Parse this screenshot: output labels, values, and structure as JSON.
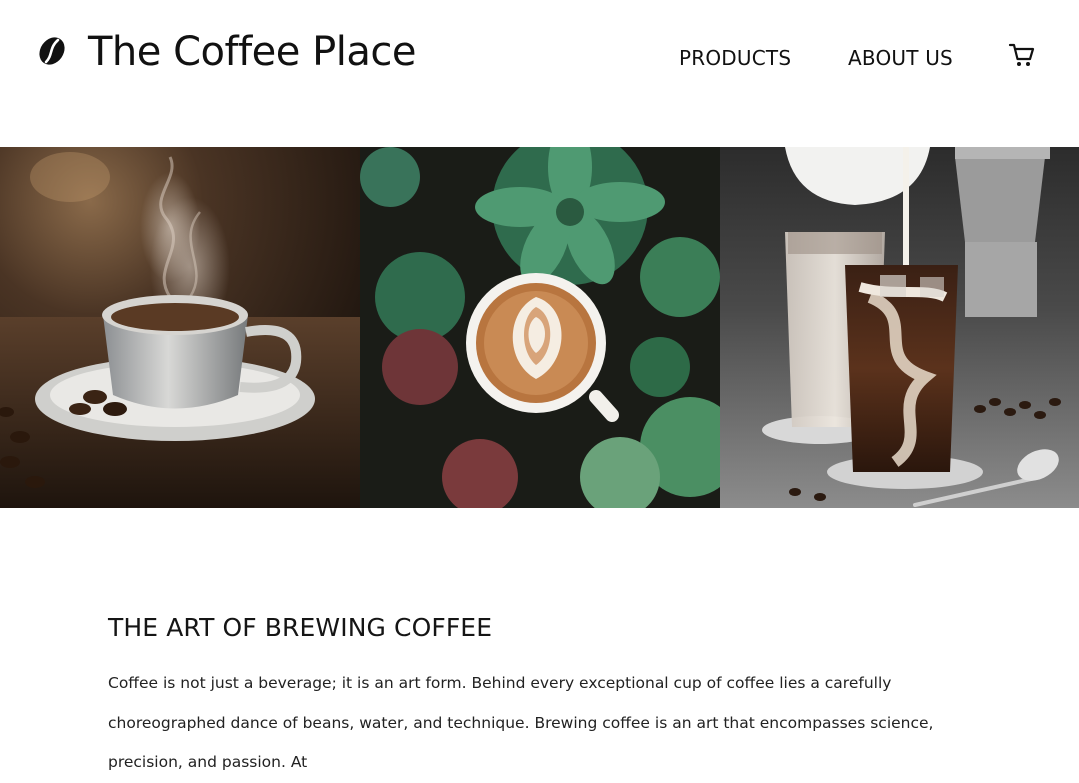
{
  "header": {
    "brand": "The Coffee Place",
    "logo_icon": "coffee-bean-icon",
    "nav": [
      {
        "label": "PRODUCTS"
      },
      {
        "label": "ABOUT US"
      }
    ],
    "cart_icon": "shopping-cart-icon"
  },
  "gallery": [
    {
      "image": "steaming coffee cup on saucer with beans"
    },
    {
      "image": "latte art cup among succulents"
    },
    {
      "image": "iced coffee with milk being poured"
    }
  ],
  "section": {
    "title": "THE ART OF BREWING COFFEE",
    "body": "Coffee is not just a beverage; it is an art form. Behind every exceptional cup of coffee lies a carefully choreographed dance of beans, water, and technique. Brewing coffee is an art that encompasses science, precision, and passion. At"
  },
  "colors": {
    "text": "#111111",
    "background": "#ffffff"
  }
}
